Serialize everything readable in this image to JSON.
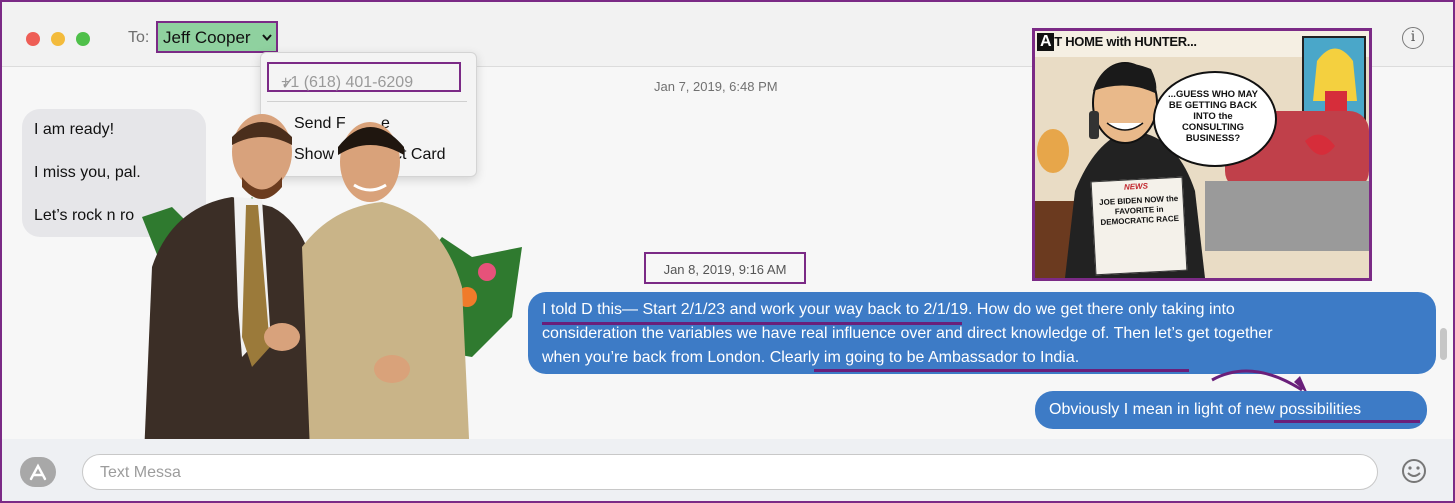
{
  "header": {
    "to_label": "To:",
    "recipient_name": "Jeff Cooper",
    "info_icon": "info-icon"
  },
  "contact_menu": {
    "phone": "+1 (618) 401-6209",
    "checkmark": "✓",
    "item_send": "Send F",
    "item_send_tail": "e",
    "item_show": "Show",
    "item_show_tail": "ct Card"
  },
  "timestamps": {
    "first": "Jan 7, 2019, 6:48 PM",
    "second": "Jan 8, 2019, 9:16 AM"
  },
  "received_messages": [
    "I am ready!",
    "I miss you, pal.",
    "Let’s rock n ro"
  ],
  "sent_message_1": {
    "lines": [
      "I told D this— Start 2/1/23 and work your way back to 2/1/19. How do we get there only taking into",
      "consideration the variables we have real influence over and direct knowledge of.  Then let’s get together",
      "when you’re back from London.  Clearly im  going to be Ambassador to India."
    ]
  },
  "sent_message_2": {
    "text": "Obviously I mean in light of new possibilities"
  },
  "cartoon": {
    "title_a": "A",
    "title_rest": "T HOME with HUNTER...",
    "speech": "...GUESS WHO MAY BE GETTING BACK INTO the CONSULTING BUSINESS?",
    "news_label": "NEWS",
    "news_headline": "JOE BIDEN NOW the FAVORITE in DEMOCRATIC RACE"
  },
  "compose": {
    "placeholder": "Text Messa"
  },
  "colors": {
    "annotation_purple": "#7b2a86",
    "sent_bubble": "#3d7bc6",
    "received_bubble": "#e6e6e9",
    "recipient_highlight": "#8fd19f"
  }
}
